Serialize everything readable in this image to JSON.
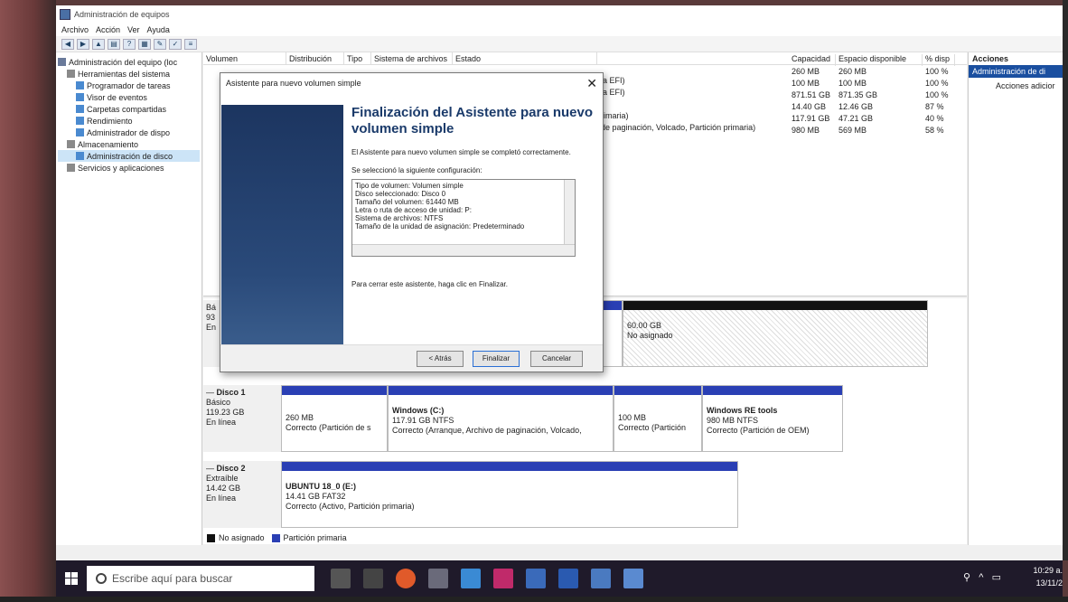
{
  "window": {
    "title": "Administración de equipos"
  },
  "menu": [
    "Archivo",
    "Acción",
    "Ver",
    "Ayuda"
  ],
  "tree": [
    {
      "label": "Administración del equipo (loc",
      "indent": 0
    },
    {
      "label": "Herramientas del sistema",
      "indent": 1
    },
    {
      "label": "Programador de tareas",
      "indent": 2
    },
    {
      "label": "Visor de eventos",
      "indent": 2
    },
    {
      "label": "Carpetas compartidas",
      "indent": 2
    },
    {
      "label": "Rendimiento",
      "indent": 2
    },
    {
      "label": "Administrador de dispo",
      "indent": 2
    },
    {
      "label": "Almacenamiento",
      "indent": 1
    },
    {
      "label": "Administración de disco",
      "indent": 2
    },
    {
      "label": "Servicios y aplicaciones",
      "indent": 1
    }
  ],
  "vol_headers": [
    "Volumen",
    "Distribución",
    "Tipo",
    "Sistema de archivos",
    "Estado"
  ],
  "vol_status": [
    "la EFI)",
    "la EFI)",
    "",
    "rimaria)",
    "de paginación, Volcado, Partición primaria)",
    ""
  ],
  "cap_headers": [
    "Capacidad",
    "Espacio disponible",
    "% disp"
  ],
  "cap_rows": [
    [
      "260 MB",
      "260 MB",
      "100 %"
    ],
    [
      "100 MB",
      "100 MB",
      "100 %"
    ],
    [
      "871.51 GB",
      "871.35 GB",
      "100 %"
    ],
    [
      "14.40 GB",
      "12.46 GB",
      "87 %"
    ],
    [
      "117.91 GB",
      "47.21 GB",
      "40 %"
    ],
    [
      "980 MB",
      "569 MB",
      "58 %"
    ]
  ],
  "disk0": {
    "label_frag": [
      "Bá",
      "93",
      "En"
    ],
    "unalloc_size": "60.00 GB",
    "unalloc_label": "No asignado"
  },
  "disk1": {
    "name": "Disco 1",
    "type": "Básico",
    "size": "119.23 GB",
    "state": "En línea",
    "parts": [
      {
        "title": "",
        "l1": "260 MB",
        "l2": "Correcto (Partición de s"
      },
      {
        "title": "Windows  (C:)",
        "l1": "117.91 GB NTFS",
        "l2": "Correcto (Arranque, Archivo de paginación, Volcado,"
      },
      {
        "title": "",
        "l1": "100 MB",
        "l2": "Correcto (Partición"
      },
      {
        "title": "Windows RE tools",
        "l1": "980 MB NTFS",
        "l2": "Correcto (Partición de OEM)"
      }
    ]
  },
  "disk2": {
    "name": "Disco 2",
    "type": "Extraíble",
    "size": "14.42 GB",
    "state": "En línea",
    "part": {
      "title": "UBUNTU 18_0  (E:)",
      "l1": "14.41 GB FAT32",
      "l2": "Correcto (Activo, Partición primaria)"
    }
  },
  "legend": [
    "No asignado",
    "Partición primaria"
  ],
  "actions": {
    "header": "Acciones",
    "selected": "Administración de di",
    "more": "Acciones adicior"
  },
  "dialog": {
    "title": "Asistente para nuevo volumen simple",
    "heading": "Finalización del Asistente para nuevo volumen simple",
    "text1": "El Asistente para nuevo volumen simple se completó correctamente.",
    "text2": "Se seleccionó la siguiente configuración:",
    "config": [
      "Tipo de volumen: Volumen simple",
      "Disco seleccionado: Disco 0",
      "Tamaño del volumen: 61440 MB",
      "Letra o ruta de acceso de unidad: P:",
      "Sistema de archivos: NTFS",
      "Tamaño de la unidad de asignación: Predeterminado"
    ],
    "text3": "Para cerrar este asistente, haga clic en Finalizar.",
    "back": "< Atrás",
    "finish": "Finalizar",
    "cancel": "Cancelar"
  },
  "taskbar": {
    "search": "Escribe aquí para buscar",
    "time": "10:29 a.",
    "date": "13/11/2"
  },
  "colors": {
    "primary_partition": "#2a3fb4",
    "unallocated": "#111111",
    "selection": "#1a4fa0"
  }
}
